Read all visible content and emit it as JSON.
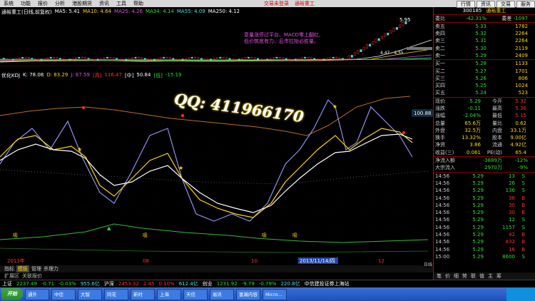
{
  "menu": {
    "items": [
      "系统",
      "功能",
      "报价",
      "分析",
      "港股期货",
      "资讯",
      "工具",
      "帮助"
    ],
    "center": [
      "交易未登录",
      "通裕重工"
    ],
    "right": [
      "行情",
      "资讯",
      "交易",
      "服务"
    ]
  },
  "ma_header": {
    "title": "通裕重工(日线,前复权)",
    "items": [
      "MA5: 5.41",
      "MA10: 4.64",
      "MA25: 4.26",
      "MA34: 4.14",
      "MA55: 4.09",
      "MA250: 4.12"
    ]
  },
  "price_chart": {
    "high_label": "5.95",
    "mid_label": "4.47 - 4.55"
  },
  "annotation": {
    "lines": [
      "意量涨停过平台、MACD零上翻红,",
      "低价筑底有力、后市拉抬必胜量。"
    ]
  },
  "indicator_header": {
    "name": "优化KDJ",
    "items": [
      "K: 78.08",
      "D: 83.29",
      "J: 67.59"
    ],
    "tags": [
      {
        "tag": "[高]",
        "val": "116.47"
      },
      {
        "tag": "[中]",
        "val": "50.84"
      },
      {
        "tag": "[低]",
        "val": "-15.19"
      }
    ]
  },
  "indicator": {
    "right_value": "100.88",
    "axis_labels": [
      "140",
      "130",
      "120",
      "110",
      "100",
      "90",
      "80",
      "70",
      "60",
      "50",
      "40",
      "30",
      "20",
      "10",
      "0",
      "-10"
    ],
    "marks": [
      "吸",
      "吸",
      "吸",
      "吸"
    ]
  },
  "watermark": "QQ: 411966170",
  "x_axis": {
    "labels": [
      "2013年",
      "08",
      "10",
      "12",
      "2013/11/14/四"
    ]
  },
  "bottom_tabs": [
    "指标",
    "模板",
    "管理",
    "杀理力"
  ],
  "bottom_tabs2": [
    "扩展区",
    "关联报价"
  ],
  "stock": {
    "code": "300185",
    "name": "通裕重工",
    "wei_bi": "-42.31%",
    "wei_cha": "委差",
    "wei_cha_val": "-1097"
  },
  "sells": [
    {
      "label": "卖五",
      "price": "5.33",
      "vol": "1782"
    },
    {
      "label": "卖四",
      "price": "5.32",
      "vol": "2264"
    },
    {
      "label": "卖三",
      "price": "5.31",
      "vol": "2264"
    },
    {
      "label": "卖二",
      "price": "5.30",
      "vol": "2119"
    },
    {
      "label": "卖一",
      "price": "5.29",
      "vol": "2409"
    }
  ],
  "buys": [
    {
      "label": "买一",
      "price": "5.28",
      "vol": "1133"
    },
    {
      "label": "买二",
      "price": "5.27",
      "vol": "1701"
    },
    {
      "label": "买三",
      "price": "5.26",
      "vol": "806"
    },
    {
      "label": "买四",
      "price": "5.25",
      "vol": "1024"
    },
    {
      "label": "买五",
      "price": "5.24",
      "vol": "523"
    }
  ],
  "quote": [
    {
      "a": "现价",
      "b": "5.29",
      "c": "今开",
      "d": "5.32"
    },
    {
      "a": "涨跌",
      "b": "-0.11",
      "c": "最高",
      "d": "5.36"
    },
    {
      "a": "涨幅",
      "b": "-2.04%",
      "c": "最低",
      "d": "5.15"
    },
    {
      "a": "总量",
      "b": "65.6万",
      "c": "量比",
      "d": "0.62"
    },
    {
      "a": "外盘",
      "b": "32.5万",
      "c": "内盘",
      "d": "33.1万"
    },
    {
      "a": "换手",
      "b": "13.32%",
      "c": "股本",
      "d": "9.00亿"
    },
    {
      "a": "净资",
      "b": "3.86",
      "c": "流通",
      "d": "4.92亿"
    },
    {
      "a": "收益(三)",
      "b": "0.061",
      "c": "PE(动)",
      "d": "65.4"
    }
  ],
  "flow": [
    {
      "a": "净流入额",
      "b": "-3889万",
      "c": "-12%"
    },
    {
      "a": "大宗流入",
      "b": "2970万",
      "c": "-9%"
    }
  ],
  "ticks": [
    {
      "t": "14:56",
      "p": "5.29",
      "v": "13",
      "s": "S"
    },
    {
      "t": "14:56",
      "p": "5.29",
      "v": "26",
      "s": "S"
    },
    {
      "t": "14:56",
      "p": "5.29",
      "v": "136",
      "s": "S"
    },
    {
      "t": "14:56",
      "p": "5.29",
      "v": "36",
      "s": "B"
    },
    {
      "t": "14:56",
      "p": "5.29",
      "v": "30",
      "s": "B"
    },
    {
      "t": "14:56",
      "p": "5.29",
      "v": "30",
      "s": "B"
    },
    {
      "t": "14:56",
      "p": "5.29",
      "v": "12",
      "s": "S"
    },
    {
      "t": "14:56",
      "p": "5.29",
      "v": "1157",
      "s": "S"
    },
    {
      "t": "14:56",
      "p": "5.29",
      "v": "42",
      "s": "B"
    },
    {
      "t": "14:56",
      "p": "5.29",
      "v": "832",
      "s": "B"
    },
    {
      "t": "14:56",
      "p": "5.29",
      "v": "16",
      "s": "B"
    },
    {
      "t": "15:00",
      "p": "5.29",
      "v": "8600",
      "s": "S"
    }
  ],
  "right_tabs": [
    "笔",
    "价",
    "细",
    "势",
    "联",
    "值",
    "主",
    "筹"
  ],
  "right_side_label": "日线",
  "status": [
    {
      "n": "上证",
      "v": "2237.49",
      "c": "-0.71",
      "p": "-0.03%",
      "a": "955.6亿"
    },
    {
      "n": "沪深",
      "v": "2453.32",
      "c": "2.45",
      "p": "0.10%",
      "a": "612.4亿"
    },
    {
      "n": "创业",
      "v": "1231.92",
      "c": "-9.79",
      "p": "-0.79%",
      "a": "220.8亿"
    }
  ],
  "status_right": "中信建投证券上海站",
  "taskbar": {
    "start": "开始",
    "tasks": [
      "通外",
      "中信",
      "大智",
      "同花",
      "新时",
      "上海",
      "天信",
      "易讯",
      "富瀚内容",
      "Micro..."
    ]
  }
}
